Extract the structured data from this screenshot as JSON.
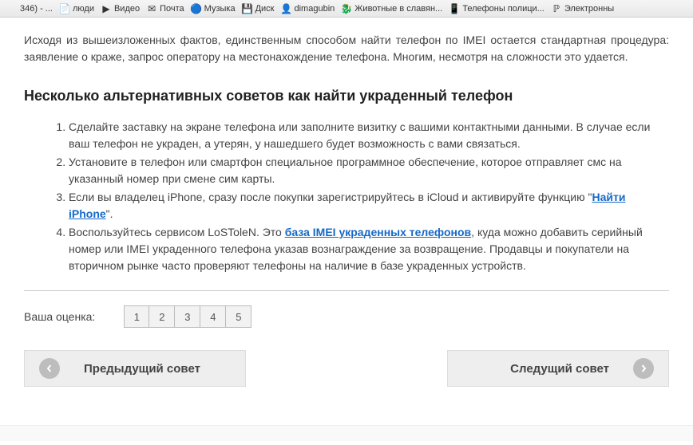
{
  "bookmarks": [
    {
      "label": "346) - ...",
      "icon": ""
    },
    {
      "label": "люди",
      "icon": "📄"
    },
    {
      "label": "Видео",
      "icon": "▶"
    },
    {
      "label": "Почта",
      "icon": "✉"
    },
    {
      "label": "Музыка",
      "icon": "🔵"
    },
    {
      "label": "Диск",
      "icon": "💾"
    },
    {
      "label": "dimagubin",
      "icon": "👤"
    },
    {
      "label": "Животные в славян...",
      "icon": "🐉"
    },
    {
      "label": "Телефоны полици...",
      "icon": "📱"
    },
    {
      "label": "Электронны",
      "icon": "ℙ"
    }
  ],
  "intro_text": "Исходя из вышеизложенных фактов, единственным способом найти телефон по IMEI остается стандартная процедура: заявление о краже, запрос оператору на местонахождение телефона. Многим, несмотря на сложности это удается.",
  "heading": "Несколько альтернативных советов как найти украденный телефон",
  "tips": {
    "item1": "Сделайте заставку на экране телефона или заполните визитку с вашими контактными данными. В случае если ваш телефон не украден, а утерян, у нашедшего будет возможность с вами связаться.",
    "item2": "Установите в телефон или смартфон специальное программное обеспечение, которое отправляет смс на указанный номер при смене сим карты.",
    "item3_a": "Если вы владелец iPhone, сразу после покупки зарегистрируйтесь в iCloud и активируйте функцию \"",
    "item3_link": "Найти iPhone",
    "item3_b": "\".",
    "item4_a": "Воспользуйтесь сервисом LoSToleN. Это ",
    "item4_link": "база IMEI украденных телефонов",
    "item4_b": ", куда можно добавить серийный номер или IMEI украденного телефона указав вознаграждение за возвращение. Продавцы и покупатели на вторичном рынке часто проверяют телефоны на наличие в базе украденных устройств."
  },
  "rating": {
    "label": "Ваша оценка:",
    "options": [
      "1",
      "2",
      "3",
      "4",
      "5"
    ]
  },
  "nav": {
    "prev": "Предыдущий совет",
    "next": "Следущий совет"
  }
}
